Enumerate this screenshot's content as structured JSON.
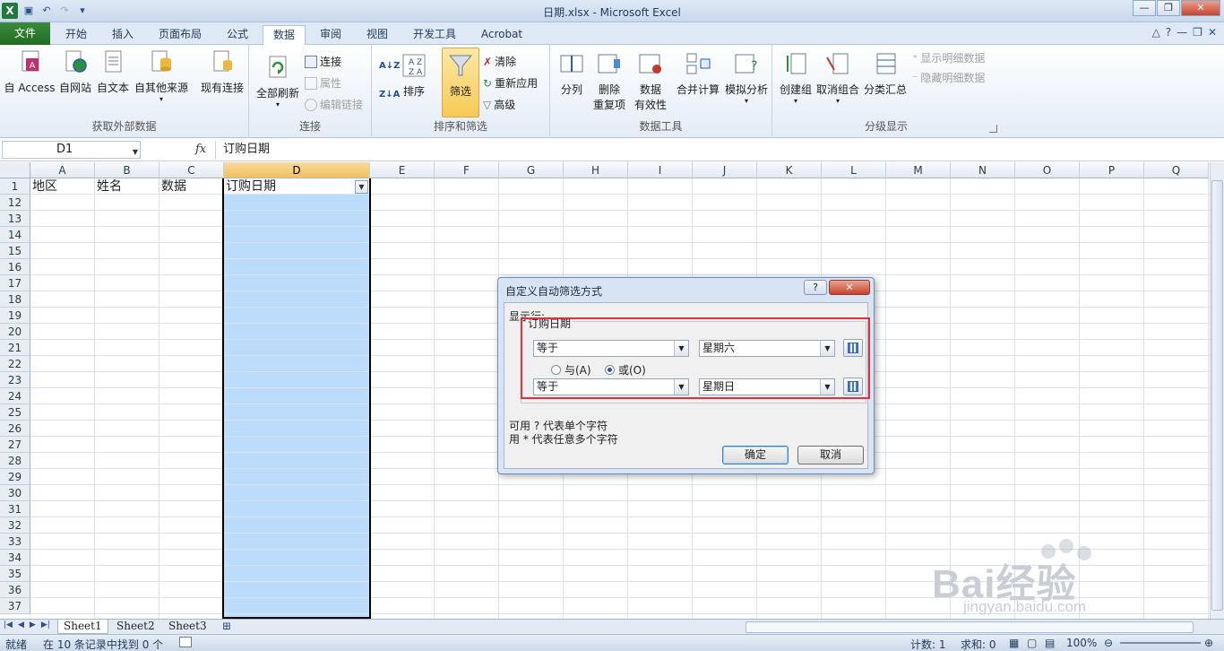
{
  "window": {
    "title": "日期.xlsx  -  Microsoft Excel"
  },
  "ribbon_tabs": [
    "文件",
    "开始",
    "插入",
    "页面布局",
    "公式",
    "数据",
    "审阅",
    "视图",
    "开发工具",
    "Acrobat"
  ],
  "ribbon": {
    "get_external": {
      "label": "获取外部数据",
      "access": "自 Access",
      "web": "自网站",
      "text": "自文本",
      "other": "自其他来源",
      "existing": "现有连接"
    },
    "connections": {
      "label": "连接",
      "refresh_all": "全部刷新",
      "connections": "连接",
      "properties": "属性",
      "edit_links": "编辑链接"
    },
    "sort_filter": {
      "label": "排序和筛选",
      "sort": "排序",
      "filter": "筛选",
      "clear": "清除",
      "reapply": "重新应用",
      "advanced": "高级"
    },
    "data_tools": {
      "label": "数据工具",
      "split": "分列",
      "remove_dup_1": "删除",
      "remove_dup_2": "重复项",
      "validation_1": "数据",
      "validation_2": "有效性",
      "consolidate": "合并计算",
      "whatif": "模拟分析"
    },
    "outline": {
      "label": "分级显示",
      "group": "创建组",
      "ungroup": "取消组合",
      "subtotal": "分类汇总",
      "show_detail": "显示明细数据",
      "hide_detail": "隐藏明细数据"
    }
  },
  "formula_bar": {
    "name_box": "D1",
    "fx": "fx",
    "content": "订购日期"
  },
  "grid": {
    "columns": [
      "A",
      "B",
      "C",
      "D",
      "E",
      "F",
      "G",
      "H",
      "I",
      "J",
      "K",
      "L",
      "M",
      "N",
      "O",
      "P",
      "Q"
    ],
    "rows": [
      "1",
      "12",
      "13",
      "14",
      "15",
      "16",
      "17",
      "18",
      "19",
      "20",
      "21",
      "22",
      "23",
      "24",
      "25",
      "26",
      "27",
      "28",
      "29",
      "30",
      "31",
      "32",
      "33",
      "34",
      "35",
      "36",
      "37"
    ],
    "header_cells": [
      "地区",
      "姓名",
      "数据",
      "订购日期"
    ]
  },
  "sheets": [
    "Sheet1",
    "Sheet2",
    "Sheet3"
  ],
  "status": {
    "ready": "就绪",
    "message": "在 10 条记录中找到 0 个",
    "count": "计数: 1",
    "sum": "求和: 0",
    "zoom": "100%"
  },
  "dialog": {
    "title": "自定义自动筛选方式",
    "help": "?",
    "show_rows": "显示行:",
    "field": "订购日期",
    "op1": "等于",
    "val1": "星期六",
    "and_label": "与(A)",
    "or_label": "或(O)",
    "op2": "等于",
    "val2": "星期日",
    "hint1": "可用 ? 代表单个字符",
    "hint2": "用 * 代表任意多个字符",
    "ok": "确定",
    "cancel": "取消",
    "selected_logic": "or"
  },
  "watermark": {
    "text": "Bai经验",
    "sub": "jingyan.baidu.com"
  },
  "colors": {
    "accent": "#1f6d22",
    "selection": "#bcdcfb",
    "highlight": "#e0313a"
  }
}
